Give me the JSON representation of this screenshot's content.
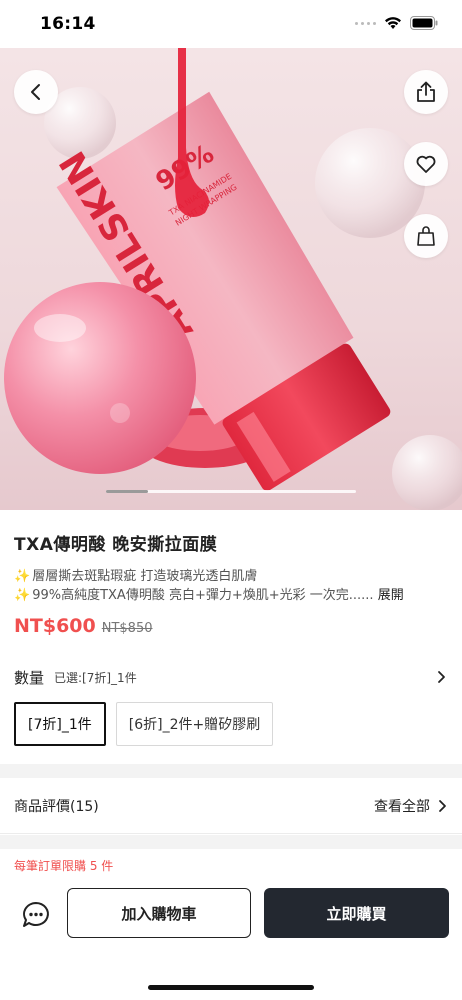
{
  "status_bar": {
    "time": "16:14"
  },
  "product": {
    "title": "TXA傳明酸 晚安撕拉面膜",
    "desc_line1": "層層撕去斑點瑕疵 打造玻璃光透白肌膚",
    "desc_line2": "99%高純度TXA傳明酸 亮白+彈力+煥肌+光彩 一次完......",
    "sparkle": "✨",
    "expand_label": "展開",
    "price": "NT$600",
    "original_price": "NT$850",
    "tube_brand": "APRILSKIN",
    "tube_percent": "99%",
    "tube_name": "TXA NIACINAMIDE",
    "tube_sub": "NIGHT WRAPPING"
  },
  "quantity": {
    "label": "數量",
    "selected_text": "已選:[7折]_1件",
    "options": [
      "[7折]_1件",
      "[6折]_2件+贈矽膠刷"
    ],
    "selected_index": 0
  },
  "reviews": {
    "label": "商品評價(15)",
    "view_all": "查看全部"
  },
  "bottom_bar": {
    "limit_note": "每筆訂單限購 5 件",
    "add_to_cart": "加入購物車",
    "buy_now": "立即購買"
  },
  "icons": {
    "back": "chevron-left-icon",
    "share": "share-icon",
    "favorite": "heart-icon",
    "bag": "shopping-bag-icon",
    "chat": "chat-bubble-icon"
  },
  "colors": {
    "accent": "#f0504f",
    "buy_button": "#232830",
    "product_pink": "#e8475e"
  }
}
